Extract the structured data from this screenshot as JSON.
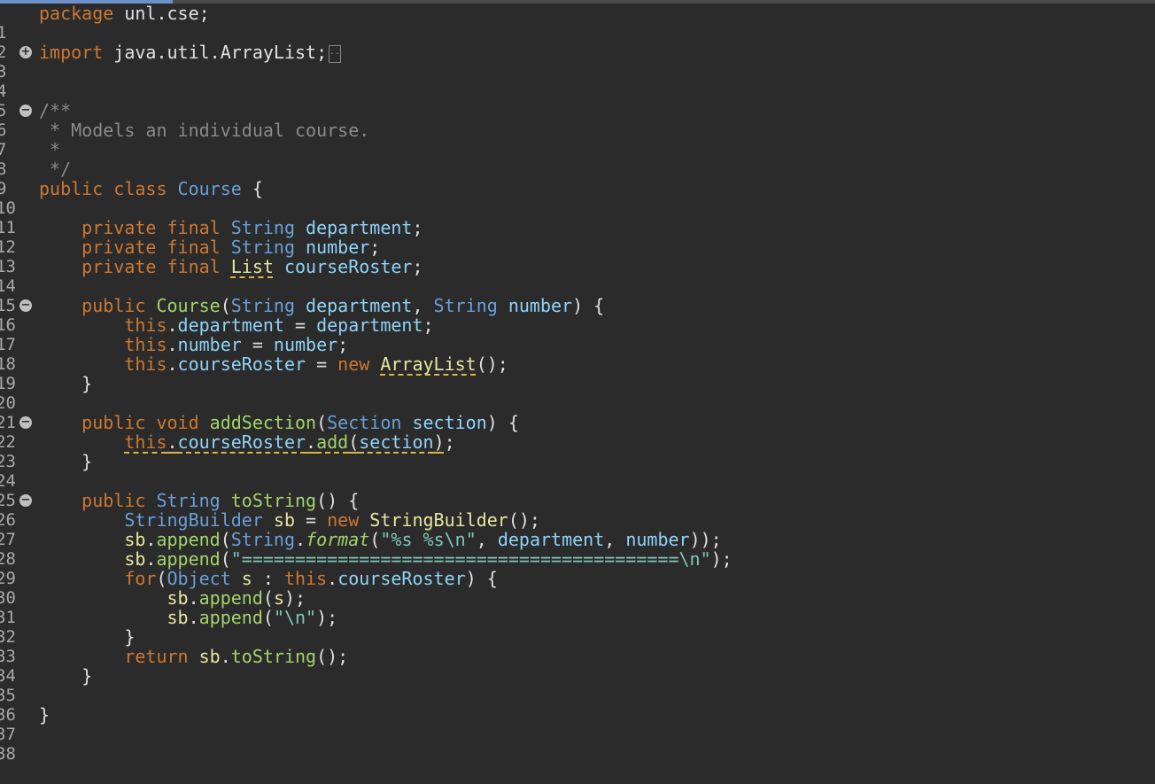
{
  "editor": {
    "line_numbers": [
      "1",
      "2",
      "3",
      "4",
      "5",
      "6",
      "7",
      "8",
      "9",
      "10",
      "11",
      "12",
      "13",
      "14",
      "15",
      "16",
      "17",
      "18",
      "19",
      "20",
      "21",
      "22",
      "23",
      "24",
      "25",
      "26",
      "27",
      "28",
      "29",
      "30",
      "31",
      "32",
      "33",
      "34",
      "35",
      "36",
      "37",
      "38"
    ],
    "tokens": {
      "l1_kw": "package",
      "l1_rest": " unl.cse;",
      "l3_kw": "import",
      "l3_rest": " java.util.ArrayList;",
      "l3_collapsed": "..",
      "l6": "/**",
      "l7": " * Models an individual course.",
      "l8": " *",
      "l9": " */",
      "l10_kw": "public class ",
      "l10_cls": "Course",
      "l10_rest": " {",
      "l12_kw": "    private final ",
      "l12_type": "String",
      "l12_fld": " department",
      "l12_end": ";",
      "l13_kw": "    private final ",
      "l13_type": "String",
      "l13_fld": " number",
      "l13_end": ";",
      "l14_kw": "    private final ",
      "l14_type": "List",
      "l14_fld": " courseRoster",
      "l14_end": ";",
      "l16_kw": "    public ",
      "l16_fn": "Course",
      "l16_p1": "(",
      "l16_t1": "String",
      "l16_v1": " department",
      "l16_c": ", ",
      "l16_t2": "String",
      "l16_v2": " number",
      "l16_end": ") {",
      "l17_kw": "        this",
      "l17_dot": ".",
      "l17_fld": "department",
      "l17_eq": " = ",
      "l17_v": "department",
      "l17_end": ";",
      "l18_kw": "        this",
      "l18_dot": ".",
      "l18_fld": "number",
      "l18_eq": " = ",
      "l18_v": "number",
      "l18_end": ";",
      "l19_kw": "        this",
      "l19_dot": ".",
      "l19_fld": "courseRoster",
      "l19_eq": " = ",
      "l19_new": "new ",
      "l19_cls": "ArrayList",
      "l19_end": "();",
      "l20": "    }",
      "l22_kw": "    public void ",
      "l22_fn": "addSection",
      "l22_p": "(",
      "l22_t": "Section",
      "l22_v": " section",
      "l22_end": ") {",
      "l23_ind": "        ",
      "l23_kw": "this",
      "l23_dot": ".",
      "l23_fld": "courseRoster",
      "l23_dot2": ".",
      "l23_fn": "add",
      "l23_p": "(",
      "l23_v": "section",
      "l23_cl": ")",
      "l23_end": ";",
      "l24": "    }",
      "l26_kw": "    public ",
      "l26_t": "String",
      "l26_fn": " toString",
      "l26_end": "() {",
      "l27_ind": "        ",
      "l27_t": "StringBuilder",
      "l27_v": " sb",
      "l27_eq": " = ",
      "l27_new": "new ",
      "l27_cls": "StringBuilder",
      "l27_end": "();",
      "l28_ind": "        ",
      "l28_v": "sb",
      "l28_dot": ".",
      "l28_fn": "append",
      "l28_p": "(",
      "l28_t": "String",
      "l28_dot2": ".",
      "l28_fn2": "format",
      "l28_p2": "(",
      "l28_str": "\"%s %s\\n\"",
      "l28_c": ", ",
      "l28_f1": "department",
      "l28_c2": ", ",
      "l28_f2": "number",
      "l28_end": "));",
      "l29_ind": "        ",
      "l29_v": "sb",
      "l29_dot": ".",
      "l29_fn": "append",
      "l29_p": "(",
      "l29_str": "\"=========================================\\n\"",
      "l29_end": ");",
      "l30_ind": "        ",
      "l30_kw": "for",
      "l30_p": "(",
      "l30_t": "Object",
      "l30_v": " s",
      "l30_c": " : ",
      "l30_kw2": "this",
      "l30_dot": ".",
      "l30_fld": "courseRoster",
      "l30_end": ") {",
      "l31_ind": "            ",
      "l31_v": "sb",
      "l31_dot": ".",
      "l31_fn": "append",
      "l31_p": "(",
      "l31_v2": "s",
      "l31_end": ");",
      "l32_ind": "            ",
      "l32_v": "sb",
      "l32_dot": ".",
      "l32_fn": "append",
      "l32_p": "(",
      "l32_str": "\"\\n\"",
      "l32_end": ");",
      "l33": "        }",
      "l34_ind": "        ",
      "l34_kw": "return",
      "l34_v": " sb",
      "l34_dot": ".",
      "l34_fn": "toString",
      "l34_end": "();",
      "l35": "    }",
      "l37": "}"
    }
  }
}
